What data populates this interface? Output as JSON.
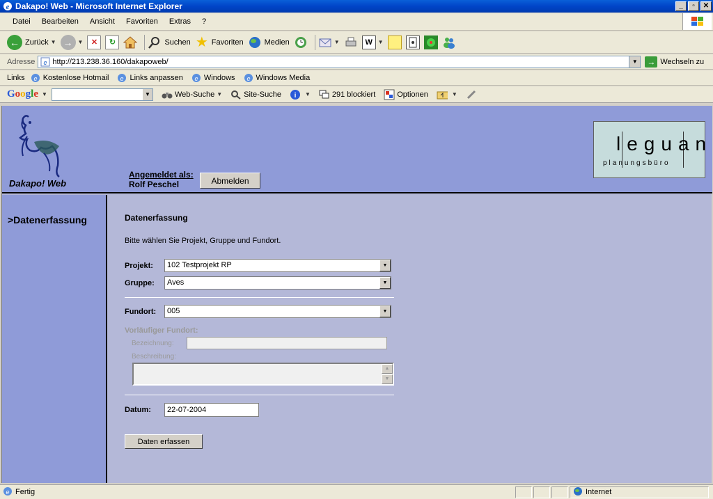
{
  "window": {
    "title": "Dakapo! Web - Microsoft Internet Explorer",
    "buttons": {
      "minimize": "_",
      "maximize": "▫",
      "close": "✕"
    }
  },
  "menu": [
    "Datei",
    "Bearbeiten",
    "Ansicht",
    "Favoriten",
    "Extras",
    "?"
  ],
  "toolbar": {
    "back": "Zurück",
    "search": "Suchen",
    "favorites": "Favoriten",
    "media": "Medien"
  },
  "address": {
    "label": "Adresse",
    "url": "http://213.238.36.160/dakapoweb/",
    "go": "Wechseln zu"
  },
  "links": {
    "label": "Links",
    "items": [
      "Kostenlose Hotmail",
      "Links anpassen",
      "Windows",
      "Windows Media"
    ]
  },
  "google": {
    "logo": "Google",
    "web_search": "Web-Suche",
    "site_search": "Site-Suche",
    "blocked": "291 blockiert",
    "options": "Optionen"
  },
  "app": {
    "name": "Dakapo! Web",
    "login_label": "Angemeldet als:",
    "user": "Rolf Peschel",
    "logout": "Abmelden",
    "brand_main": "leguan",
    "brand_sub": "planungsbüro"
  },
  "sidebar": {
    "items": [
      ">Datenerfassung"
    ]
  },
  "form": {
    "title": "Datenerfassung",
    "instruction": "Bitte wählen Sie Projekt, Gruppe und Fundort.",
    "projekt_label": "Projekt:",
    "projekt_value": "102 Testprojekt RP",
    "gruppe_label": "Gruppe:",
    "gruppe_value": "Aves",
    "fundort_label": "Fundort:",
    "fundort_value": "005",
    "vorl_label": "Vorläufiger Fundort:",
    "bezeichnung_label": "Bezeichnung:",
    "beschreibung_label": "Beschreibung:",
    "datum_label": "Datum:",
    "datum_value": "22-07-2004",
    "submit": "Daten erfassen"
  },
  "status": {
    "text": "Fertig",
    "zone": "Internet"
  }
}
